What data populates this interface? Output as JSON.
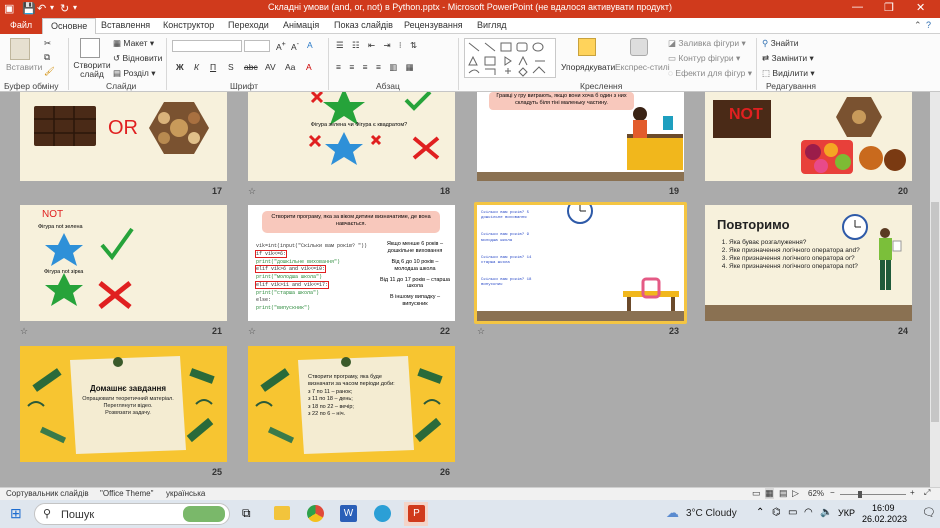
{
  "window": {
    "title": "Складні умови (and, or, not) в Python.pptx  -  Microsoft PowerPoint (не вдалося активувати продукт)"
  },
  "tabs": [
    "Файл",
    "Основне",
    "Вставлення",
    "Конструктор",
    "Переходи",
    "Анімація",
    "Показ слайдів",
    "Рецензування",
    "Вигляд"
  ],
  "ribbon": {
    "paste": "Вставити",
    "new_slide": "Створити слайд",
    "layout": "Макет",
    "reset": "Відновити",
    "section": "Розділ",
    "arrange": "Упорядкувати",
    "quick_styles": "Експрес-стилі",
    "shape_fill": "Заливка фігури",
    "shape_outline": "Контур фігури",
    "shape_effects": "Ефекти для фігур",
    "find": "Знайти",
    "replace": "Замінити",
    "select": "Виділити",
    "groups": {
      "clipboard": "Буфер обміну",
      "slides": "Слайди",
      "font": "Шрифт",
      "paragraph": "Абзац",
      "drawing": "Креслення",
      "editing": "Редагування"
    }
  },
  "slides": {
    "s17": {
      "num": "17",
      "or_word": "OR"
    },
    "s18": {
      "num": "18",
      "text": "Фігура зелена чи Фігура є квадратом?"
    },
    "s19": {
      "num": "19",
      "text": "Гравці у гру виграють, якщо вони хоча б один з них складуть біля тіні маленьку частину."
    },
    "s20": {
      "num": "20",
      "not_word": "NOT"
    },
    "s21": {
      "num": "21",
      "title": "NOT",
      "l1": "Фігура not зелена",
      "l2": "Фігура not зірка"
    },
    "s22": {
      "num": "22",
      "task": "Створити програму, яка за віком дитини визначатиме, де вона навчається.",
      "code": [
        "vik=int(input(\"Скільки вам років? \"))",
        "if vik<=6:",
        "    print(\"дошкільне виховання\")",
        "elif vik>6 and vik<=10:",
        "    print(\"молодша школа\")",
        "elif vik>11 and vik<=17:",
        "    print(\"старша школа\")",
        "else:",
        "    print(\"випускник\")"
      ],
      "notes": [
        "Якщо менше 6 років – дошкільне виховання",
        "Від 6 до 10 років – молодша школа",
        "Від 11 до 17 років – старша школа",
        "В іншому випадку – випускник"
      ]
    },
    "s23": {
      "num": "23",
      "lines": [
        "Скільки вам років? 5",
        "дошкільне виховання",
        "Скільки вам років? 9",
        "молодша школа",
        "Скільки вам років? 14",
        "старша школа",
        "Скільки вам років? 18",
        "випускник"
      ]
    },
    "s24": {
      "num": "24",
      "title": "Повторимо",
      "items": [
        "Яка буває розгалуження?",
        "Яке призначення логічного оператора and?",
        "Яке призначення логічного оператора or?",
        "Яке призначення логічного оператора not?"
      ]
    },
    "s25": {
      "num": "25",
      "title": "Домашнє завдання",
      "lines": [
        "Опрацювати теоретичний матеріал.",
        "Переглянути відео.",
        "Розвязати задачу."
      ]
    },
    "s26": {
      "num": "26",
      "lines": [
        "Створити програму, яка буде визначати за часом періоди доби:",
        "з 7 по 11 – ранок;",
        "з 11 по 18 – день;",
        "з 18 по 22 – вечір;",
        "з 22 по 6 – ніч."
      ]
    }
  },
  "status": {
    "view": "Сортувальник слайдів",
    "theme": "\"Office Theme\"",
    "lang": "українська",
    "zoom": "62%"
  },
  "taskbar": {
    "search": "Пошук",
    "weather": "3°C  Cloudy",
    "lang": "УКР",
    "time": "16:09",
    "date": "26.02.2023"
  },
  "colors": {
    "accent": "#d03a1c",
    "yellow": "#f7c531",
    "cream": "#f7f1dc",
    "brown": "#8a7152"
  }
}
